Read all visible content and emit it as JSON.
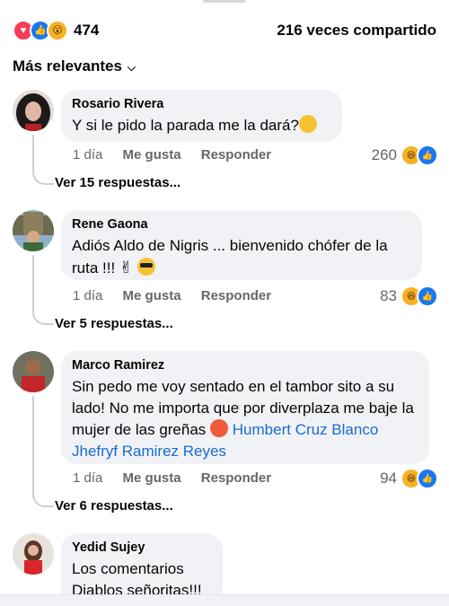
{
  "summary": {
    "reaction_count": "474",
    "shares": "216 veces compartido",
    "reaction_icons": [
      "heart-icon",
      "like-icon",
      "wow-icon"
    ]
  },
  "sort": {
    "label": "Más relevantes"
  },
  "actions": {
    "like": "Me gusta",
    "reply": "Responder"
  },
  "comments": [
    {
      "author": "Rosario Rivera",
      "text": "Y si le pido la parada me la dará?",
      "time": "1 día",
      "reactions": "260",
      "replies": "Ver 15 respuestas..."
    },
    {
      "author": "Rene Gaona",
      "text": "Adiós Aldo de Nigris  ... bienvenido chófer de la ruta !!!",
      "time": "1 día",
      "reactions": "83",
      "replies": "Ver 5 respuestas..."
    },
    {
      "author": "Marco Ramirez",
      "text": "Sin pedo me voy sentado en el tambor sito a su lado! No me importa que por diverplaza me baje la mujer de las greñas",
      "mention1": "Humbert Cruz Blanco",
      "mention2": "Jhefryf Ramirez Reyes",
      "time": "1 día",
      "reactions": "94",
      "replies": "Ver 6 respuestas..."
    },
    {
      "author": "Yedid Sujey",
      "text_line1": "Los comentarios",
      "text_line2": "Diablos señoritas!!!"
    }
  ],
  "colors": {
    "bubble": "#f0f2f5",
    "link": "#1b6ad1",
    "meta": "#65676b",
    "like_blue": "#1877f2",
    "heart_red": "#f33e58"
  }
}
